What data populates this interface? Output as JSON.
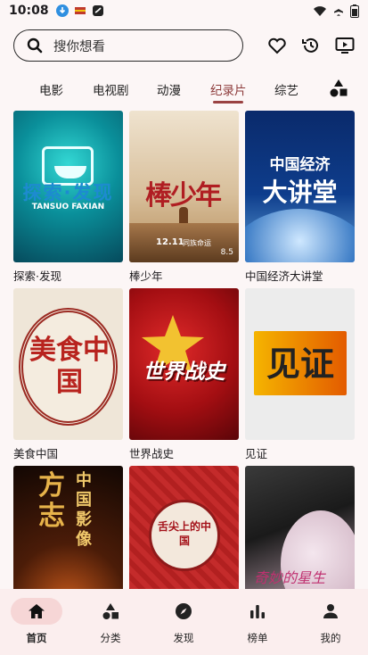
{
  "status_bar": {
    "time": "10:08",
    "icons": [
      "download-icon",
      "flag-icon",
      "app-icon",
      "wifi-icon",
      "airplane-icon",
      "battery-icon"
    ]
  },
  "search": {
    "placeholder": "搜你想看"
  },
  "top_actions": [
    "heart-icon",
    "history-icon",
    "screen-cast-icon"
  ],
  "tabs": [
    {
      "label": "电影",
      "active": false
    },
    {
      "label": "电视剧",
      "active": false
    },
    {
      "label": "动漫",
      "active": false
    },
    {
      "label": "纪录片",
      "active": true
    },
    {
      "label": "综艺",
      "active": false
    }
  ],
  "poster_texts": {
    "tansuo_main": "探索·发现",
    "tansuo_pinyin": "TANSUO  FAXIAN",
    "bang_main": "棒少年",
    "bang_date": "12.11",
    "bang_release": "同族命运",
    "bang_score": "8.5",
    "zgjj_line1": "中国经济",
    "zgjj_line2": "大讲堂",
    "meishi_main": "美食中国",
    "sjzs_main": "世界战史",
    "jianzheng_main": "见证",
    "fangzhi_left": "方志",
    "fangzhi_right": "中国影像",
    "shejian_main": "舌尖上的中国",
    "qimiao_main": "奇妙的星生"
  },
  "items": [
    {
      "title": "探索·发现"
    },
    {
      "title": "棒少年"
    },
    {
      "title": "中国经济大讲堂"
    },
    {
      "title": "美食中国"
    },
    {
      "title": "世界战史"
    },
    {
      "title": "见证"
    },
    {
      "title": ""
    },
    {
      "title": ""
    },
    {
      "title": ""
    }
  ],
  "bottom_nav": [
    {
      "label": "首页",
      "icon": "home-icon",
      "active": true
    },
    {
      "label": "分类",
      "icon": "category-icon",
      "active": false
    },
    {
      "label": "发现",
      "icon": "compass-icon",
      "active": false
    },
    {
      "label": "榜单",
      "icon": "chart-icon",
      "active": false
    },
    {
      "label": "我的",
      "icon": "person-icon",
      "active": false
    }
  ],
  "colors": {
    "accent": "#9a4242",
    "active_pill": "#f6d6d6",
    "background": "#fcf6f6"
  }
}
